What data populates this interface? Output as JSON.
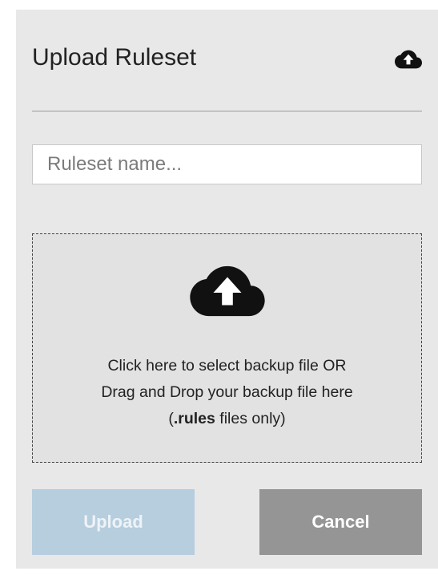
{
  "dialog": {
    "title": "Upload Ruleset",
    "header_icon": "cloud-upload-icon"
  },
  "name_field": {
    "placeholder": "Ruleset name...",
    "value": ""
  },
  "dropzone": {
    "icon": "cloud-upload-icon",
    "line1": "Click here to select backup file OR",
    "line2": "Drag and Drop your backup file here",
    "line3_prefix": "(",
    "line3_ext": ".rules",
    "line3_suffix": " files only)"
  },
  "buttons": {
    "upload_label": "Upload",
    "upload_state": "disabled",
    "cancel_label": "Cancel"
  },
  "colors": {
    "panel_bg": "#e8e8e8",
    "upload_bg": "#b6cede",
    "cancel_bg": "#959595"
  }
}
